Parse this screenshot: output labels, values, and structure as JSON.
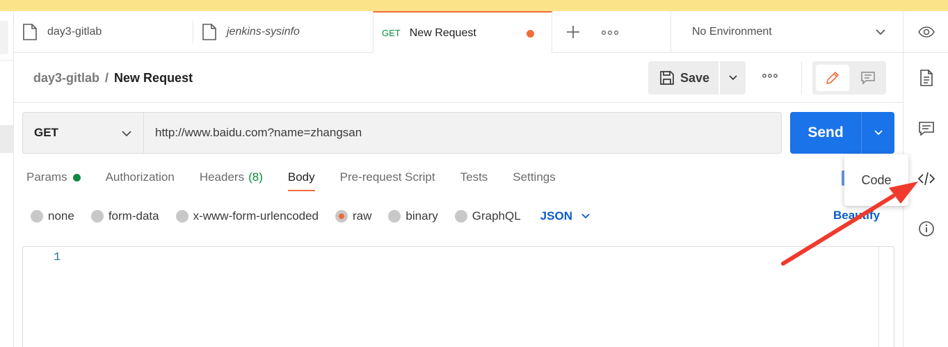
{
  "tabs": [
    {
      "label": "day3-gitlab"
    },
    {
      "label": "jenkins-sysinfo"
    },
    {
      "method": "GET",
      "label": "New Request"
    }
  ],
  "environment": {
    "label": "No Environment"
  },
  "breadcrumb": {
    "parent": "day3-gitlab",
    "separator": "/",
    "current": "New Request"
  },
  "toolbar": {
    "save_label": "Save"
  },
  "request": {
    "method": "GET",
    "url": "http://www.baidu.com?name=zhangsan",
    "send_label": "Send"
  },
  "request_tabs": [
    {
      "label": "Params"
    },
    {
      "label": "Authorization"
    },
    {
      "label": "Headers",
      "count": "(8)"
    },
    {
      "label": "Body"
    },
    {
      "label": "Pre-request Script"
    },
    {
      "label": "Tests"
    },
    {
      "label": "Settings"
    }
  ],
  "body_types": [
    {
      "label": "none"
    },
    {
      "label": "form-data"
    },
    {
      "label": "x-www-form-urlencoded"
    },
    {
      "label": "raw"
    },
    {
      "label": "binary"
    },
    {
      "label": "GraphQL"
    }
  ],
  "body_language": "JSON",
  "beautify_label": "Beautify",
  "editor": {
    "line_number": "1"
  },
  "tooltip": {
    "label": "Code"
  },
  "colors": {
    "accent": "#f26b3a",
    "send": "#1a73e8",
    "link": "#0b5cc9",
    "success": "#0b8a3f",
    "annotation_arrow": "#f03a2e"
  }
}
